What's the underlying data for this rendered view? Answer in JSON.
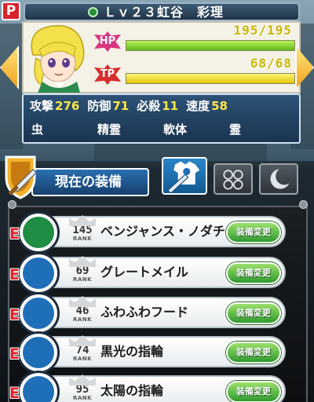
{
  "header": {
    "badge": "P",
    "level_name": "Ｌｖ２３虹谷　彩理"
  },
  "status": {
    "hp": {
      "label": "HP",
      "text": "195/195",
      "fraction": 1.0
    },
    "tp": {
      "label": "TP",
      "text": "68/68",
      "fraction": 1.0
    }
  },
  "stats": [
    {
      "label": "攻撃",
      "value": "276"
    },
    {
      "label": "防御",
      "value": "71"
    },
    {
      "label": "必殺",
      "value": "11"
    },
    {
      "label": "速度",
      "value": "58"
    }
  ],
  "traits": [
    "虫",
    "精霊",
    "軟体",
    "霊"
  ],
  "equipment": {
    "title": "現在の装備",
    "tabs": [
      {
        "name": "weapon-tab",
        "icon": "shirt-sword-icon"
      },
      {
        "name": "accessory-tab",
        "icon": "accessory-icon"
      },
      {
        "name": "special-tab",
        "icon": "moon-icon"
      }
    ],
    "items": [
      {
        "grade": "E",
        "rank": "145",
        "rank_label": "RANK",
        "name": "ベンジャンス・ノダチ",
        "button": "装備変更",
        "icon": "sword-icon",
        "color": "#1f8d43"
      },
      {
        "grade": "E",
        "rank": "69",
        "rank_label": "RANK",
        "name": "グレートメイル",
        "button": "装備変更",
        "icon": "shirt-icon",
        "color": "#1e6fb8"
      },
      {
        "grade": "E",
        "rank": "46",
        "rank_label": "RANK",
        "name": "ふわふわフード",
        "button": "装備変更",
        "icon": "helmet-icon",
        "color": "#1e6fb8"
      },
      {
        "grade": "E",
        "rank": "74",
        "rank_label": "RANK",
        "name": "黒光の指輪",
        "button": "装備変更",
        "icon": "ring-icon",
        "color": "#1e6fb8"
      },
      {
        "grade": "E",
        "rank": "95",
        "rank_label": "RANK",
        "name": "太陽の指輪",
        "button": "装備変更",
        "icon": "ring-icon",
        "color": "#1e6fb8"
      }
    ]
  }
}
